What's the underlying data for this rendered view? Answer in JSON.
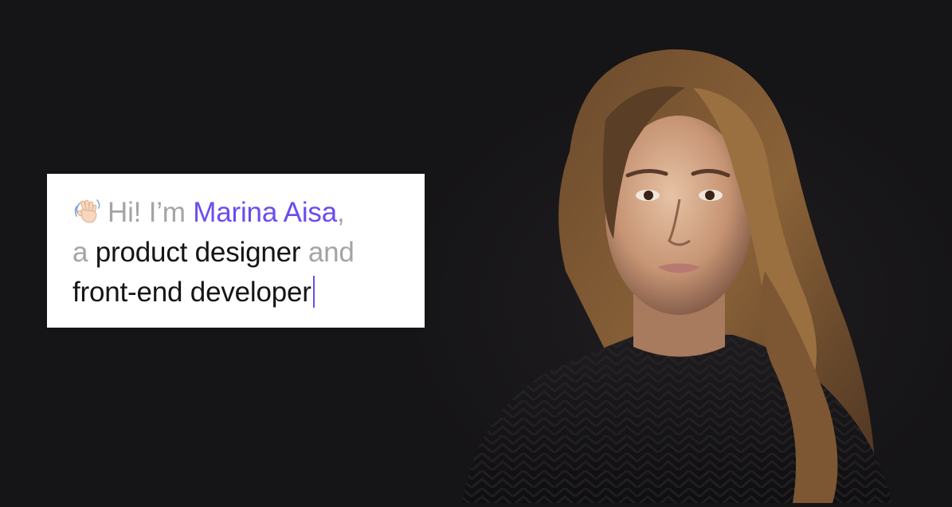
{
  "intro": {
    "greeting_icon": "waving-hand-icon",
    "line1": {
      "greeting": "Hi! I’m",
      "name": "Marina Aisa",
      "comma": ","
    },
    "line2": {
      "article": "a",
      "role1": "product designer",
      "conjunction": "and"
    },
    "line3": {
      "role2": "front-end developer"
    }
  },
  "colors": {
    "background": "#151416",
    "card": "#ffffff",
    "accent": "#6a4cf0",
    "muted_text": "#a4a4a4",
    "strong_text": "#151416"
  },
  "portrait": {
    "icon": "person-portrait-photo"
  }
}
